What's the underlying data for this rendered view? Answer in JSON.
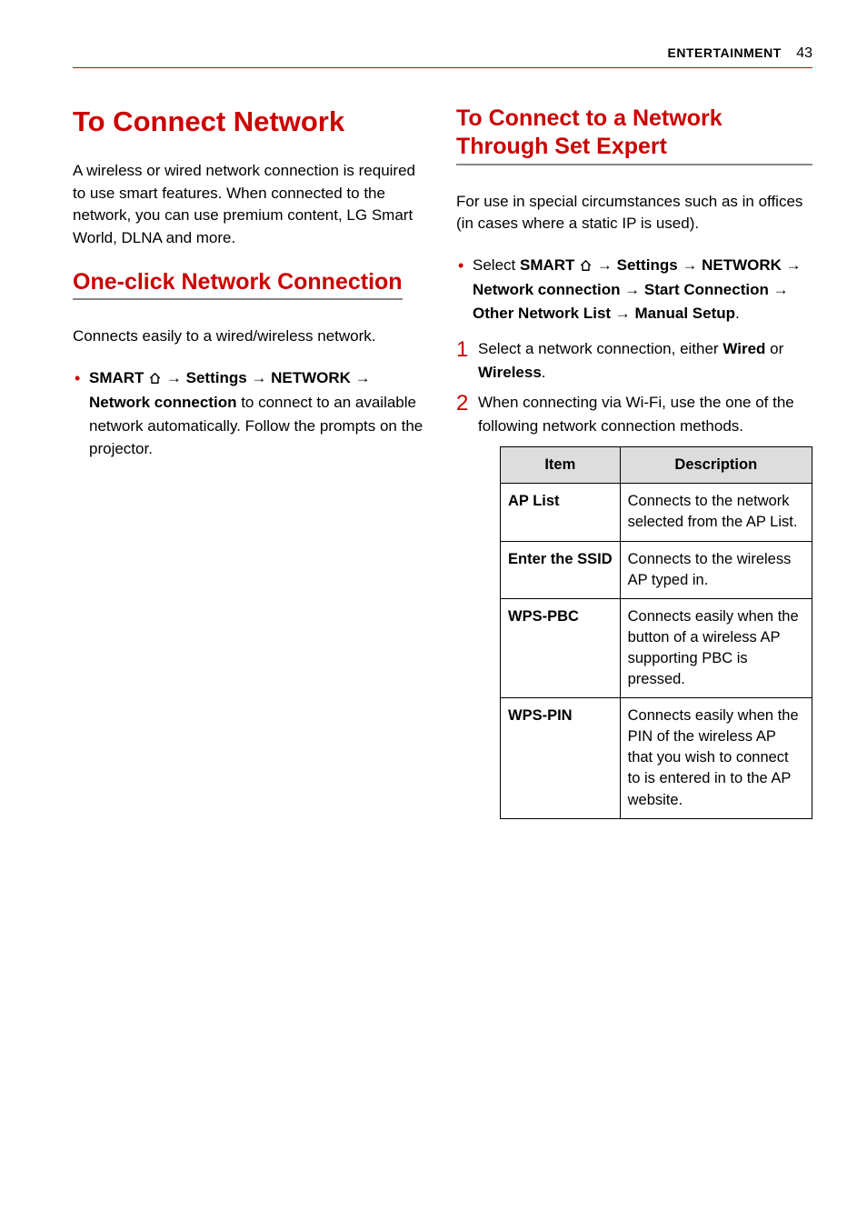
{
  "header": {
    "section": "ENTERTAINMENT",
    "page": "43"
  },
  "left": {
    "h1": "To Connect Network",
    "intro": "A wireless or wired network connection is required to use smart features. When connected to the network, you can use premium content, LG Smart World, DLNA and more.",
    "h2": "One-click Network Connection",
    "h2_sub": "Connects easily to a wired/wireless network.",
    "bullet_prefix": "SMART ",
    "bullet_path1": " → Settings → NETWORK → Network connection",
    "bullet_tail": " to connect to an available network automatically. Follow the prompts on the projector."
  },
  "right": {
    "h2": "To Connect to a Network Through Set Expert",
    "intro": "For use in special circumstances such as in offices (in cases where a static IP is used).",
    "bullet_prefix": "Select ",
    "bullet_smart": "SMART ",
    "bullet_path": " → Settings → NETWORK → Network connection → Start Connection → Other Network List → Manual Setup",
    "bullet_period": ".",
    "step1_a": "Select a network connection, either ",
    "step1_b": "Wired",
    "step1_c": " or ",
    "step1_d": "Wireless",
    "step1_e": ".",
    "step2": "When connecting via Wi-Fi, use the one of the following network connection methods.",
    "table": {
      "head_item": "Item",
      "head_desc": "Description",
      "rows": [
        {
          "item": "AP List",
          "desc": "Connects to the network selected from the AP List."
        },
        {
          "item": "Enter the SSID",
          "desc": "Connects to the wireless AP typed in."
        },
        {
          "item": "WPS-PBC",
          "desc": "Connects easily when the button of a wireless AP supporting PBC is pressed."
        },
        {
          "item": "WPS-PIN",
          "desc": "Connects easily when the PIN of the wireless AP that you wish to connect to is entered in to the AP website."
        }
      ]
    }
  }
}
